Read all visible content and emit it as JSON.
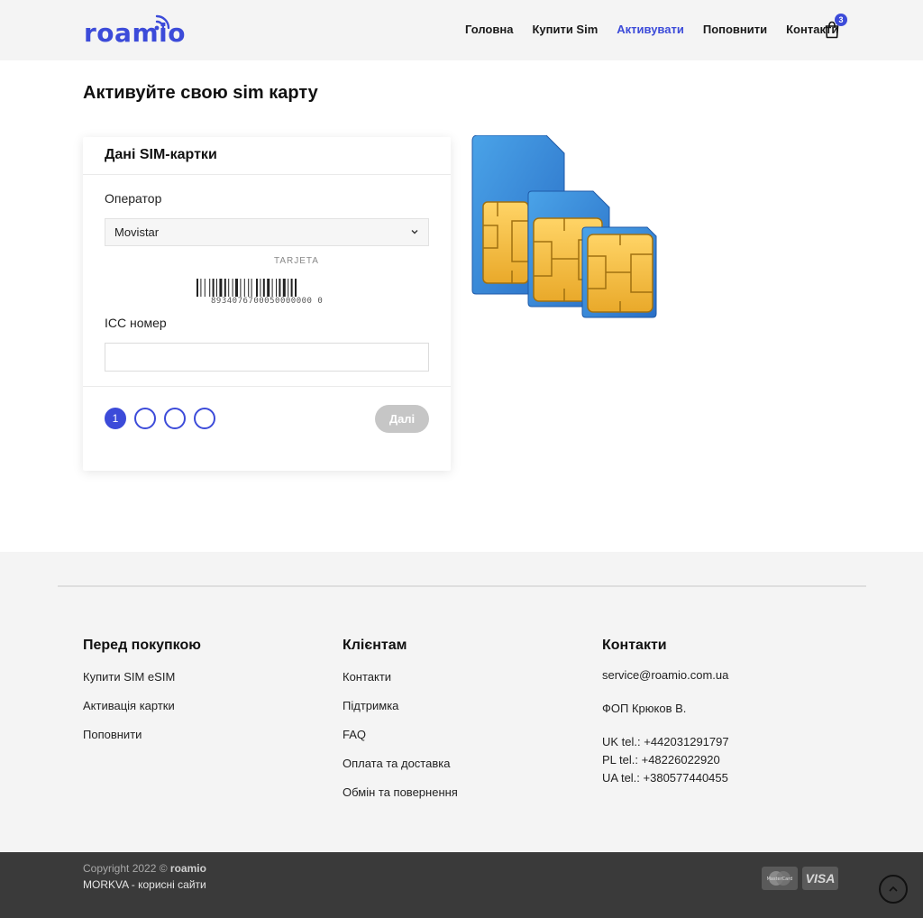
{
  "brand": {
    "name": "roamio",
    "color": "#3c4bd9"
  },
  "nav": {
    "items": [
      {
        "label": "Головна",
        "active": false
      },
      {
        "label": "Купити Sim",
        "active": false
      },
      {
        "label": "Активувати",
        "active": true
      },
      {
        "label": "Поповнити",
        "active": false
      },
      {
        "label": "Контакти",
        "active": false
      }
    ],
    "cart_count": "3",
    "cart_icon": "shopping-bag-icon"
  },
  "page": {
    "title": "Активуйте свою sim карту"
  },
  "form": {
    "card_title": "Дані SIM-картки",
    "operator_label": "Оператор",
    "operator_value": "Movistar",
    "barcode_title": "TARJETA",
    "barcode_digits": "8934076700050000000 0",
    "icc_label": "ICC номер",
    "icc_value": "",
    "steps": [
      "1",
      "",
      "",
      ""
    ],
    "current_step": 1,
    "next_label": "Далі"
  },
  "footer": {
    "col1": {
      "title": "Перед покупкою",
      "links": [
        "Купити SIM eSIM",
        "Активація картки",
        "Поповнити"
      ]
    },
    "col2": {
      "title": "Клієнтам",
      "links": [
        "Контакти",
        "Підтримка",
        "FAQ",
        "Оплата та доставка",
        "Обмін та повернення"
      ]
    },
    "col3": {
      "title": "Контакти",
      "email": "service@roamio.com.ua",
      "company": "ФОП Крюков В.",
      "phones": [
        "UK tel.: +442031291797",
        "PL tel.: +48226022920",
        "UA tel.: +380577440455"
      ]
    },
    "copyright_prefix": "Copyright 2022 © ",
    "copyright_brand": "roamio",
    "credit": "MORKVA - корисні сайти",
    "payments": [
      "MasterCard",
      "VISA"
    ]
  }
}
